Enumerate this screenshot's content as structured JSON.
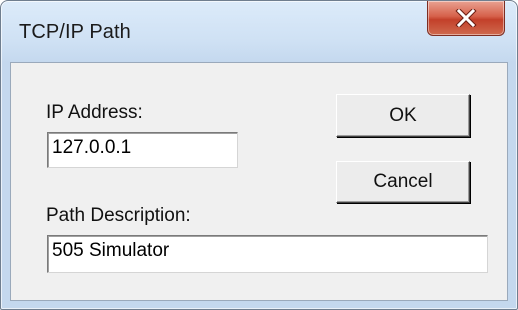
{
  "window": {
    "title": "TCP/IP Path"
  },
  "form": {
    "ip_label": "IP Address:",
    "ip_value": "127.0.0.1",
    "path_label": "Path Description:",
    "path_value": "505 Simulator"
  },
  "buttons": {
    "ok_label": "OK",
    "cancel_label": "Cancel"
  },
  "icons": {
    "close": "close-icon"
  },
  "colors": {
    "close_button": "#c8452f",
    "dialog_face": "#f0f0f0",
    "frame": "#c4d8ee"
  }
}
